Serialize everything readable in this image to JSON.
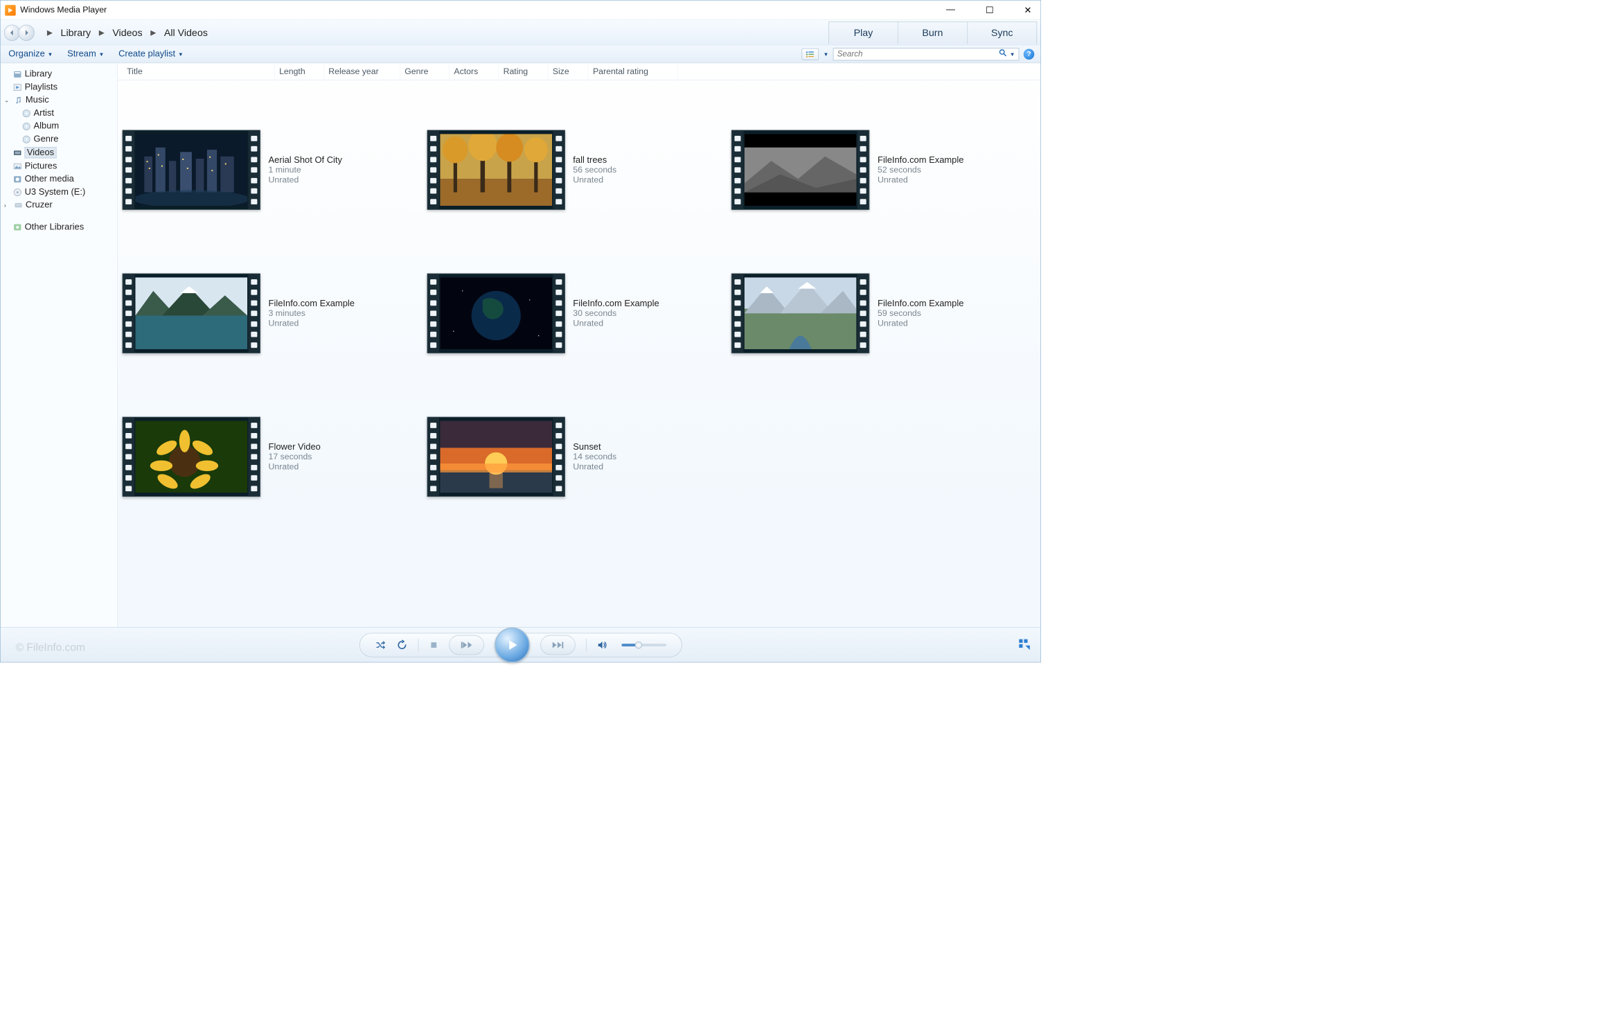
{
  "title": "Windows Media Player",
  "breadcrumbs": [
    "Library",
    "Videos",
    "All Videos"
  ],
  "tabs": {
    "play": "Play",
    "burn": "Burn",
    "sync": "Sync"
  },
  "toolbar": {
    "organize": "Organize",
    "stream": "Stream",
    "create_playlist": "Create playlist"
  },
  "search": {
    "placeholder": "Search"
  },
  "columns": [
    "Title",
    "Length",
    "Release year",
    "Genre",
    "Actors",
    "Rating",
    "Size",
    "Parental rating"
  ],
  "sidebar": {
    "library": "Library",
    "playlists": "Playlists",
    "music": "Music",
    "artist": "Artist",
    "album": "Album",
    "genre": "Genre",
    "videos": "Videos",
    "pictures": "Pictures",
    "other_media": "Other media",
    "u3": "U3 System (E:)",
    "cruzer": "Cruzer",
    "other_libraries": "Other Libraries"
  },
  "videos": [
    {
      "title": "Aerial Shot Of City",
      "length": "1 minute",
      "rating": "Unrated"
    },
    {
      "title": "fall trees",
      "length": "56 seconds",
      "rating": "Unrated"
    },
    {
      "title": "FileInfo.com Example",
      "length": "52 seconds",
      "rating": "Unrated"
    },
    {
      "title": "FileInfo.com Example",
      "length": "3 minutes",
      "rating": "Unrated"
    },
    {
      "title": "FileInfo.com Example",
      "length": "30 seconds",
      "rating": "Unrated"
    },
    {
      "title": "FileInfo.com Example",
      "length": "59 seconds",
      "rating": "Unrated"
    },
    {
      "title": "Flower Video",
      "length": "17 seconds",
      "rating": "Unrated"
    },
    {
      "title": "Sunset",
      "length": "14 seconds",
      "rating": "Unrated"
    }
  ],
  "watermark": "© FileInfo.com"
}
